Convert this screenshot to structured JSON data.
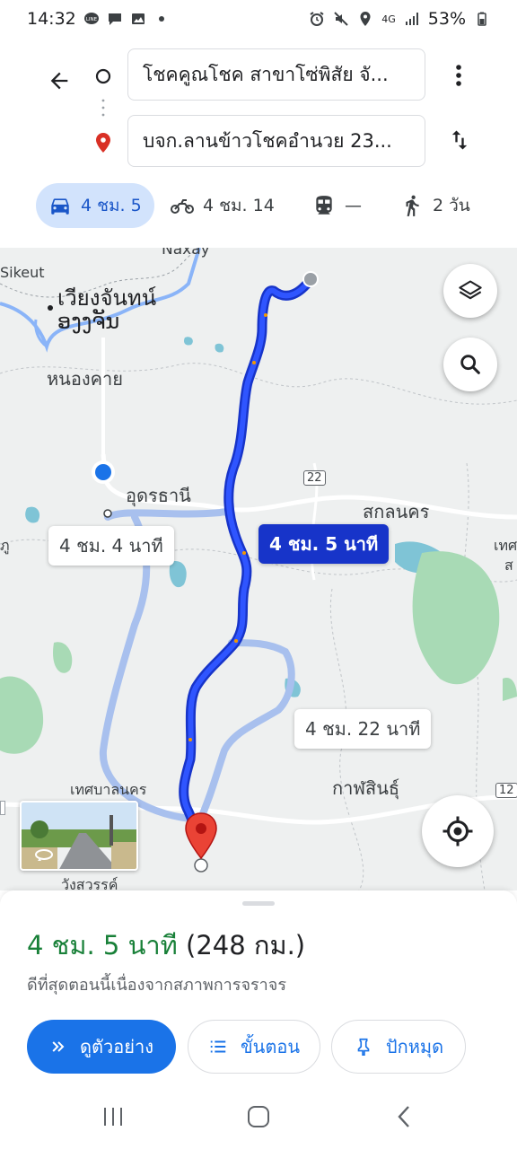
{
  "status": {
    "time": "14:32",
    "battery": "53%",
    "network": "4G"
  },
  "directions": {
    "origin": "โชคคูณโชค สาขาโซ่พิสัย จั...",
    "destination": "บจก.ลานข้าวโชคอำนวย 23..."
  },
  "modes": [
    {
      "name": "car",
      "label": "4 ชม. 5"
    },
    {
      "name": "motorcycle",
      "label": "4 ชม. 14"
    },
    {
      "name": "transit",
      "label": "—"
    },
    {
      "name": "walk",
      "label": "2 วัน"
    }
  ],
  "map": {
    "labels": {
      "naxay": "Naxay",
      "sikeut": "Sikeut",
      "vientiane_lao": "เวียงจันทน์",
      "vientiane_sub": "ອງງຈັນ",
      "nong_khai": "หนองคาย",
      "udon": "อุดรธานี",
      "sakon": "สกลนคร",
      "thet_right": "เทศ",
      "sa_right": "ส",
      "phu_left": "ภู",
      "thetsaban": "เทศบาลนคร",
      "kalasin": "กาฬสินธุ์",
      "wang": "วังสวรรค์"
    },
    "shields": {
      "r22": "22",
      "r12": "12"
    },
    "callouts": {
      "alt1": "4 ชม. 4 นาที",
      "selected": "4 ชม. 5 นาที",
      "alt2": "4 ชม. 22 นาที"
    }
  },
  "sheet": {
    "duration": "4 ชม. 5 นาที",
    "distance": "(248 กม.)",
    "reason": "ดีที่สุดตอนนี้เนื่องจากสภาพการจราจร",
    "buttons": {
      "preview": "ดูตัวอย่าง",
      "steps": "ขั้นตอน",
      "pin": "ปักหมุด"
    }
  },
  "colors": {
    "route": "#1a3ae0",
    "alt_route": "#a8c0ee",
    "accent": "#1a73e8",
    "duration_green": "#188038"
  }
}
